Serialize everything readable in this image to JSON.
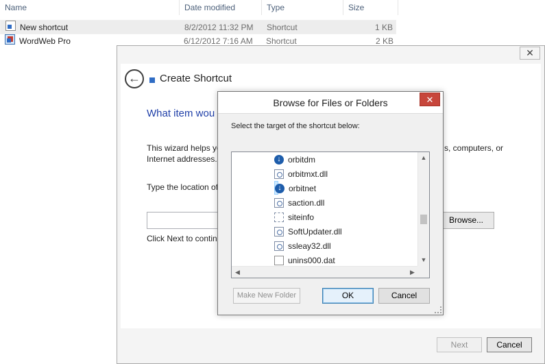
{
  "explorer": {
    "columns": {
      "name": "Name",
      "date": "Date modified",
      "type": "Type",
      "size": "Size"
    },
    "files": [
      {
        "name": "New shortcut",
        "date": "8/2/2012 11:32 PM",
        "type": "Shortcut",
        "size": "1 KB",
        "icon": "shortcut-icon"
      },
      {
        "name": "WordWeb Pro",
        "date": "6/12/2012 7:16 AM",
        "type": "Shortcut",
        "size": "2 KB",
        "icon": "app-shortcut-icon"
      }
    ]
  },
  "wizard": {
    "title": "Create Shortcut",
    "close_glyph": "✕",
    "back_glyph": "←",
    "heading": "What item wou",
    "intro_left_1": "This wizard helps yo",
    "intro_left_2": "Internet addresses.",
    "intro_right": "s, computers, or",
    "location_label": "Type the location of",
    "browse_label": "Browse...",
    "next_hint": "Click Next to contin",
    "next_label": "Next",
    "cancel_label": "Cancel"
  },
  "browse_dialog": {
    "title": "Browse for Files or Folders",
    "close_glyph": "✕",
    "instruction": "Select the target of the shortcut below:",
    "items": [
      {
        "label": "orbitdm",
        "icon": "orbit-icon"
      },
      {
        "label": "orbitmxt.dll",
        "icon": "dll-icon"
      },
      {
        "label": "orbitnet",
        "icon": "orbit-icon",
        "selected": true
      },
      {
        "label": "saction.dll",
        "icon": "dll-icon"
      },
      {
        "label": "siteinfo",
        "icon": "config-file-icon"
      },
      {
        "label": "SoftUpdater.dll",
        "icon": "dll-icon"
      },
      {
        "label": "ssleay32.dll",
        "icon": "dll-icon"
      },
      {
        "label": "unins000.dat",
        "icon": "dat-file-icon"
      }
    ],
    "make_new_folder_label": "Make New Folder",
    "ok_label": "OK",
    "cancel_label": "Cancel"
  }
}
